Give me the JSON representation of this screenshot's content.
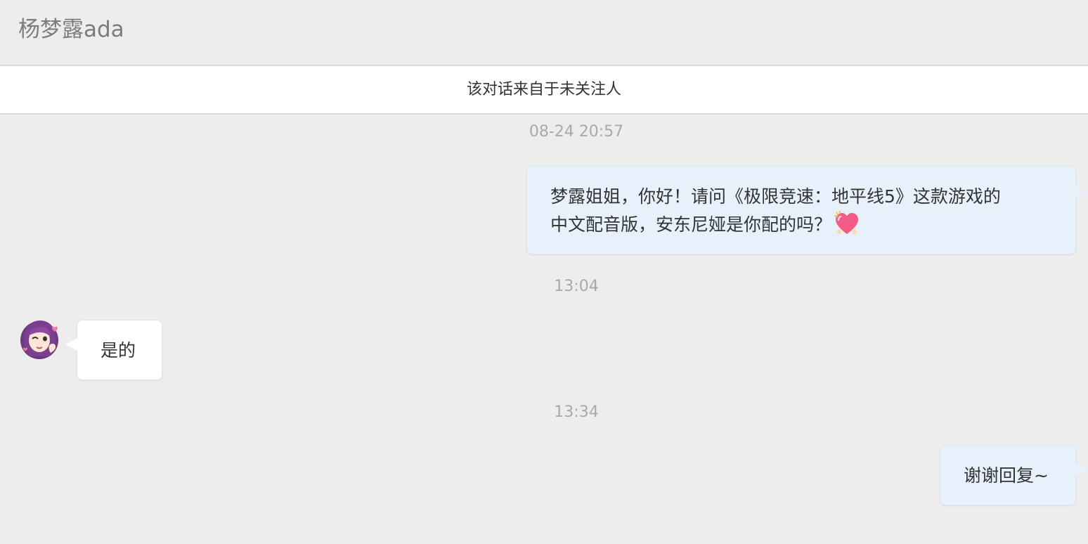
{
  "header": {
    "title": "杨梦露ada"
  },
  "notice": {
    "text": "该对话来自于未关注人"
  },
  "messages": [
    {
      "timestamp": "08-24 20:57",
      "direction": "outgoing",
      "line1": "梦露姐姐，你好！请问《极限竞速：地平线5》这款游戏的",
      "line2": "中文配音版，安东尼娅是你配的吗？",
      "emoji": "heart-emoji"
    },
    {
      "timestamp": "13:04",
      "direction": "incoming",
      "text": "是的",
      "avatar": "avatar-icon"
    },
    {
      "timestamp": "13:34",
      "direction": "outgoing",
      "text": "谢谢回复~"
    }
  ],
  "colors": {
    "background": "#ededed",
    "outgoing_bubble": "#e7f1fb",
    "incoming_bubble": "#ffffff",
    "timestamp": "#a9a9a9",
    "title": "#7c7c7c"
  }
}
